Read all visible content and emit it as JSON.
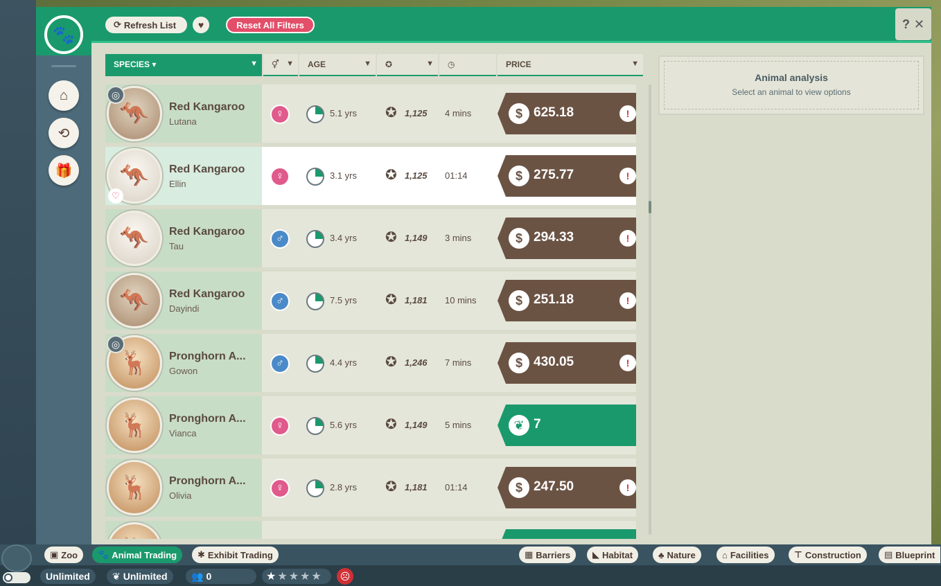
{
  "header": {
    "refresh_label": "Refresh List",
    "reset_label": "Reset All Filters",
    "help": "?",
    "close": "✕"
  },
  "columns": {
    "species": "SPECIES ▾",
    "age": "AGE",
    "price": "PRICE"
  },
  "rows": [
    {
      "species": "Red Kangaroo",
      "name": "Lutana",
      "sex": "female",
      "age": "5.1 yrs",
      "rep": "1,125",
      "time": "4 mins",
      "price": "625.18",
      "price_type": "money",
      "warning": true
    },
    {
      "species": "Red Kangaroo",
      "name": "Ellin",
      "sex": "female",
      "age": "3.1 yrs",
      "rep": "1,125",
      "time": "01:14",
      "price": "275.77",
      "price_type": "money",
      "warning": true
    },
    {
      "species": "Red Kangaroo",
      "name": "Tau",
      "sex": "male",
      "age": "3.4 yrs",
      "rep": "1,149",
      "time": "3 mins",
      "price": "294.33",
      "price_type": "money",
      "warning": true
    },
    {
      "species": "Red Kangaroo",
      "name": "Dayindi",
      "sex": "male",
      "age": "7.5 yrs",
      "rep": "1,181",
      "time": "10 mins",
      "price": "251.18",
      "price_type": "money",
      "warning": true
    },
    {
      "species": "Pronghorn A...",
      "name": "Gowon",
      "sex": "male",
      "age": "4.4 yrs",
      "rep": "1,246",
      "time": "7 mins",
      "price": "430.05",
      "price_type": "money",
      "warning": true
    },
    {
      "species": "Pronghorn A...",
      "name": "Vianca",
      "sex": "female",
      "age": "5.6 yrs",
      "rep": "1,149",
      "time": "5 mins",
      "price": "7",
      "price_type": "conservation",
      "warning": false
    },
    {
      "species": "Pronghorn A...",
      "name": "Olivia",
      "sex": "female",
      "age": "2.8 yrs",
      "rep": "1,181",
      "time": "01:14",
      "price": "247.50",
      "price_type": "money",
      "warning": true
    }
  ],
  "analysis": {
    "title": "Animal analysis",
    "subtitle": "Select an animal to view options"
  },
  "bottom_tabs": {
    "zoo": "Zoo",
    "animal_trading": "Animal Trading",
    "exhibit_trading": "Exhibit Trading",
    "barriers": "Barriers",
    "habitat": "Habitat",
    "nature": "Nature",
    "facilities": "Facilities",
    "construction": "Construction",
    "blueprints": "Blueprint"
  },
  "stats": {
    "money": "Unlimited",
    "conservation": "Unlimited",
    "guests": "0",
    "rating_stars": 1
  }
}
